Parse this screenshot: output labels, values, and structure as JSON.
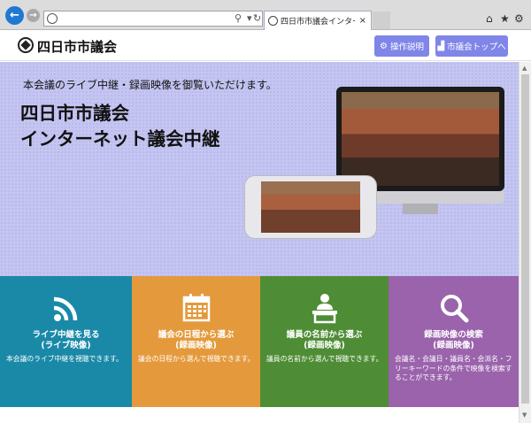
{
  "browser": {
    "tab_title": "四日市市議会インターネット...",
    "tab_close": "×"
  },
  "header": {
    "logo": "四日市市議会",
    "buttons": [
      {
        "label": "操作説明",
        "icon": "gear-icon"
      },
      {
        "label": "市議会トップへ",
        "icon": "chart-icon"
      }
    ]
  },
  "hero": {
    "tagline": "本会議のライブ中継・録画映像を御覧いただけます。",
    "title_line1": "四日市市議会",
    "title_line2": "インターネット議会中継"
  },
  "tiles": [
    {
      "title": "ライブ中継を見る",
      "subtitle": "(ライブ映像)",
      "desc": "本会議のライブ中継を視聴できます。",
      "icon": "wifi-signal-icon",
      "color": "#1a89a8"
    },
    {
      "title": "議会の日程から選ぶ",
      "subtitle": "(録画映像)",
      "desc": "議会の日程から選んで視聴できます。",
      "icon": "calendar-icon",
      "color": "#e49a3c"
    },
    {
      "title": "議員の名前から選ぶ",
      "subtitle": "(録画映像)",
      "desc": "議員の名前から選んで視聴できます。",
      "icon": "speaker-podium-icon",
      "color": "#4e8d35"
    },
    {
      "title": "録画映像の検索",
      "subtitle": "(録画映像)",
      "desc": "会議名・会議日・議員名・会派名・フリーキーワードの条件で映像を検索することができます。",
      "icon": "search-icon",
      "color": "#9a63ac"
    }
  ]
}
